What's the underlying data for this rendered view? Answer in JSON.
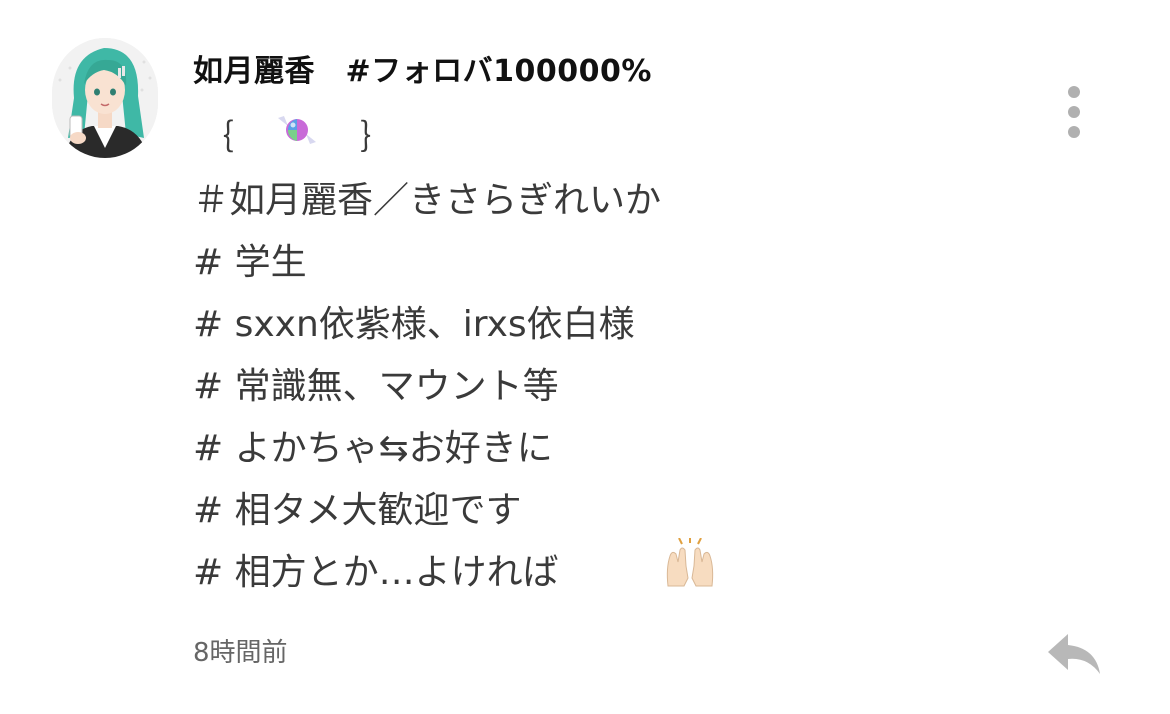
{
  "post": {
    "username": "如月麗香　#フォロバ100000%",
    "deco": {
      "open_brace": "｛",
      "close_brace": "｝"
    },
    "bio_lines": [
      "＃如月麗香／きさらぎれいか",
      "# 学生",
      "# sxxn依紫様、irxs依白様",
      "# 常識無、マウント等",
      "# よかちゃ⇆お好きに",
      "# 相タメ大歓迎です",
      "# 相方とか…よければ"
    ],
    "timestamp": "8時間前"
  },
  "icons": {
    "avatar": "avatar-illustration",
    "more": "more-vertical-icon",
    "reply": "reply-icon",
    "candy": "candy-icon",
    "clap": "raised-hands-icon"
  },
  "colors": {
    "text": "#3a3a3a",
    "username": "#111111",
    "muted": "#b0b0b0",
    "avatar_hair": "#3fb8a6"
  }
}
